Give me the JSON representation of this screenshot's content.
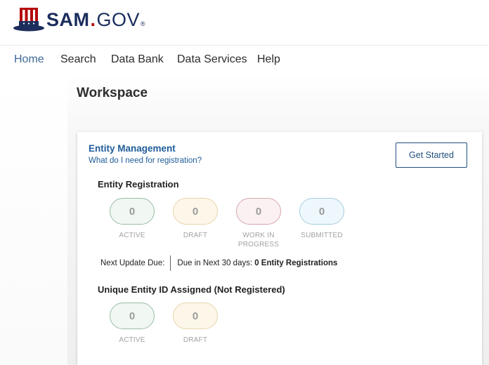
{
  "brand": {
    "name": "SAM",
    "dot": ".",
    "suffix": "GOV",
    "registered": "®"
  },
  "nav": {
    "items": [
      {
        "label": "Home",
        "active": true
      },
      {
        "label": "Search",
        "active": false
      },
      {
        "label": "Data Bank",
        "active": false
      },
      {
        "label": "Data Services",
        "active": false
      },
      {
        "label": "Help",
        "active": false
      }
    ]
  },
  "page": {
    "title": "Workspace"
  },
  "card": {
    "title": "Entity Management",
    "link": "What do I need for registration?",
    "button": "Get Started",
    "registration": {
      "title": "Entity Registration",
      "statuses": [
        {
          "count": "0",
          "label": "ACTIVE"
        },
        {
          "count": "0",
          "label": "DRAFT"
        },
        {
          "count": "0",
          "label": "WORK IN PROGRESS"
        },
        {
          "count": "0",
          "label": "SUBMITTED"
        }
      ],
      "next_update_label": "Next Update Due:",
      "due_text": "Due in Next 30 days:",
      "due_count": "0 Entity Registrations"
    },
    "uei": {
      "title": "Unique Entity ID Assigned (Not Registered)",
      "statuses": [
        {
          "count": "0",
          "label": "ACTIVE"
        },
        {
          "count": "0",
          "label": "DRAFT"
        }
      ]
    }
  },
  "colors": {
    "brand_navy": "#1b2d5c",
    "brand_red": "#b50909",
    "link_blue": "#1f5c99",
    "active_green": "#99bea6",
    "draft_gold": "#e8d5ac",
    "progress_red": "#d6a7ad",
    "submitted_blue": "#a5cfe0"
  },
  "icons": {
    "logo": "uncle-sam-hat-icon"
  }
}
